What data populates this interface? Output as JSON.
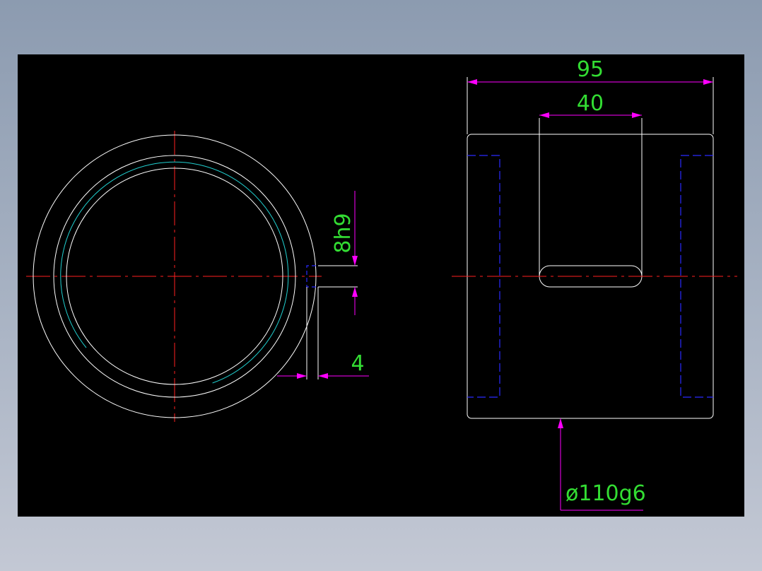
{
  "colors": {
    "background": "#000000",
    "outline": "#ffffff",
    "centerline": "#ff2020",
    "hidden": "#2a2aff",
    "thread": "#20d0d0",
    "dimension_line": "#ff00ff",
    "dimension_text": "#33dd33"
  },
  "dimensions": {
    "overall_width": "95",
    "keyway_width": "40",
    "key_slot": "8h9",
    "key_depth": "4",
    "outer_diameter": "ø110g6"
  }
}
